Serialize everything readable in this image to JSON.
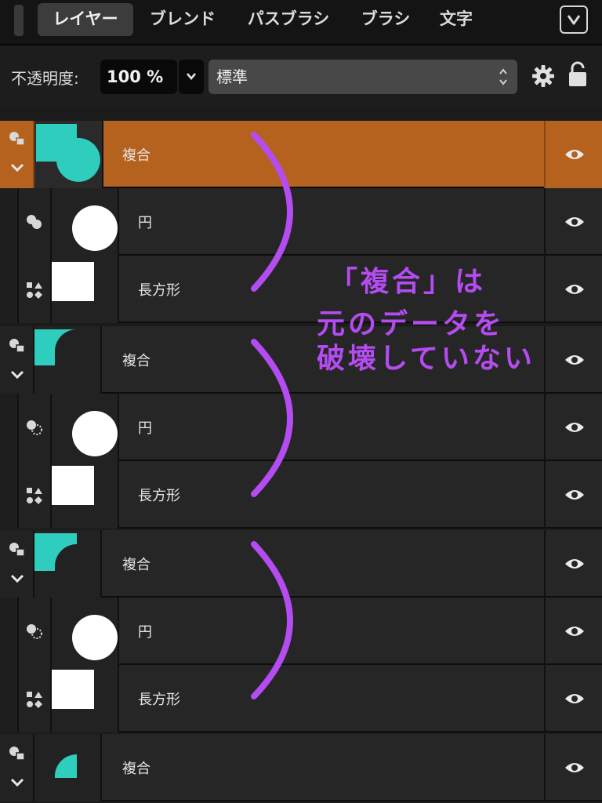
{
  "tabs": [
    {
      "label": "レイヤー",
      "active": true
    },
    {
      "label": "ブレンド",
      "active": false
    },
    {
      "label": "パスブラシ",
      "active": false
    },
    {
      "label": "ブラシ",
      "active": false
    },
    {
      "label": "文字",
      "active": false
    }
  ],
  "options": {
    "opacity_label": "不透明度:",
    "opacity_value": "100 %",
    "blend_mode": "標準"
  },
  "layers": [
    {
      "name": "複合",
      "type": "compound",
      "selected": true
    },
    {
      "name": "円",
      "type": "circle",
      "selected": false
    },
    {
      "name": "長方形",
      "type": "rectangle",
      "selected": false
    },
    {
      "name": "複合",
      "type": "compound",
      "selected": false
    },
    {
      "name": "円",
      "type": "circle",
      "selected": false
    },
    {
      "name": "長方形",
      "type": "rectangle",
      "selected": false
    },
    {
      "name": "複合",
      "type": "compound",
      "selected": false
    },
    {
      "name": "円",
      "type": "circle",
      "selected": false
    },
    {
      "name": "長方形",
      "type": "rectangle",
      "selected": false
    },
    {
      "name": "複合",
      "type": "compound",
      "selected": false
    }
  ],
  "annotation": {
    "lines": [
      "「複合」は",
      "元のデータを",
      "破壊していない"
    ],
    "color": "#b44cf2"
  },
  "colors": {
    "selected": "#b5621f",
    "teal": "#2ecdbe",
    "annotation": "#b44cf2"
  }
}
